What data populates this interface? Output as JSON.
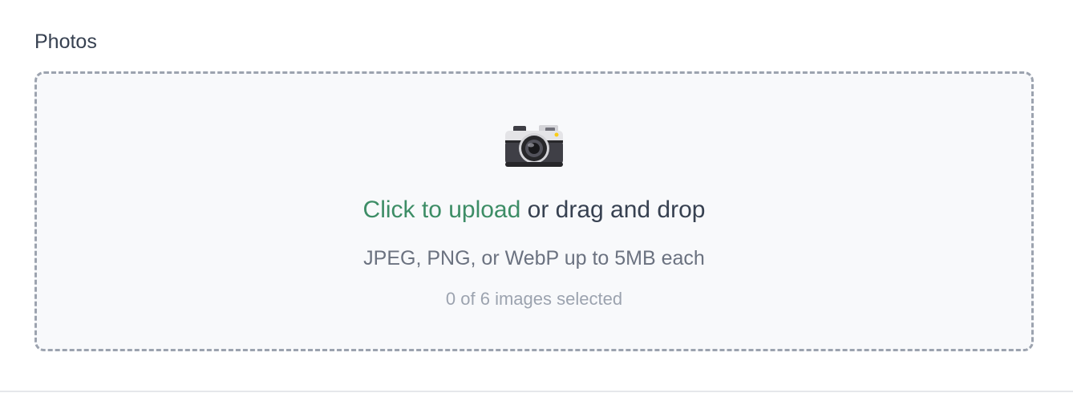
{
  "field": {
    "label": "Photos"
  },
  "dropzone": {
    "icon": "camera-icon",
    "link_text": "Click to upload",
    "rest_text": " or drag and drop",
    "hint": "JPEG, PNG, or WebP up to 5MB each",
    "count_text": "0 of 6 images selected"
  },
  "colors": {
    "accent": "#3d8d66",
    "border": "#9ca3af",
    "dropzone_bg": "#f8f9fb",
    "text": "#374151",
    "muted": "#6b7280",
    "faint": "#9ca3af"
  }
}
